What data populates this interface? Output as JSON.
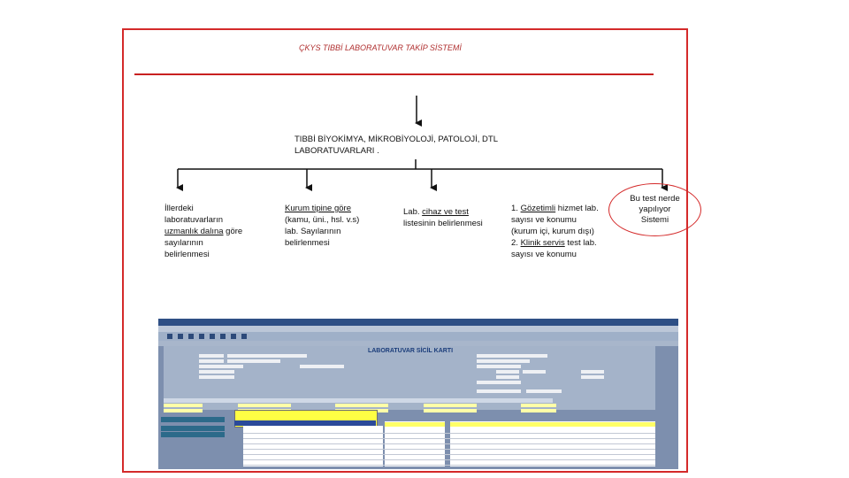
{
  "title": "ÇKYS TIBBİ LABORATUVAR TAKİP SİSTEMİ",
  "root": "TIBBİ BİYOKİMYA, MİKROBİYOLOJİ, PATOLOJİ, DTL LABORATUVARLARI .",
  "nodes": {
    "n1": {
      "a": "İllerdeki laboratuvarların ",
      "b": "uzmanlık dalına",
      "c": " göre sayılarının belirlenmesi"
    },
    "n2": {
      "a": "Kurum tipine göre",
      "b": " (kamu, üni., hsl. v.s) lab. Sayılarının belirlenmesi"
    },
    "n3": {
      "a": "Lab. ",
      "b": "cihaz ve test",
      "c": " listesinin belirlenmesi"
    },
    "n4": {
      "a": "1. ",
      "b": "Gözetimli",
      "c": " hizmet lab. sayısı ve konumu (kurum içi, kurum dışı)",
      "d": "2. ",
      "e": "Klinik servis",
      "f": " test lab. sayısı ve konumu"
    }
  },
  "callout": "Bu test nerde\nyapılıyor\nSistemi",
  "screenshot": {
    "form_title": "LABORATUVAR SİCİL KARTI"
  },
  "colors": {
    "frame": "#d42a2a",
    "rule": "#c82020",
    "title": "#b03030"
  }
}
